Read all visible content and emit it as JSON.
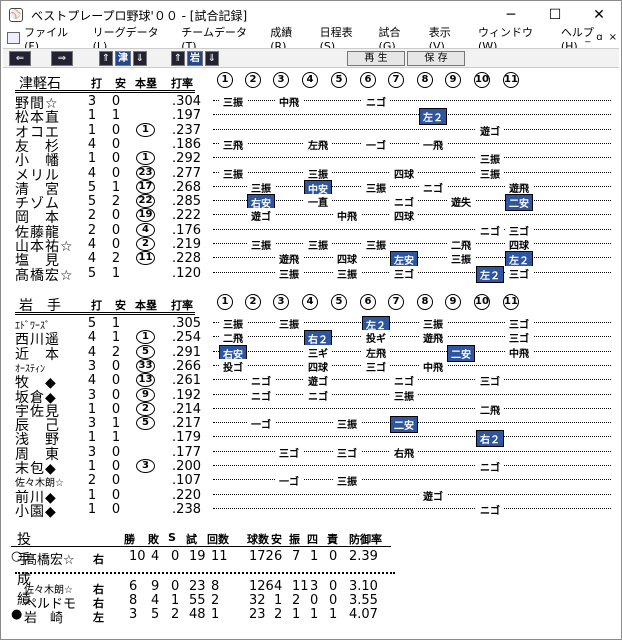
{
  "window": {
    "title": "ベストプレープロ野球'００ - [試合記録]",
    "buttons": [
      "─",
      "☐",
      "✕"
    ]
  },
  "menu": [
    "ファイル(F)",
    "リーグデータ(L)",
    "チームデータ(T)",
    "成績(R)",
    "日程表(S)",
    "試合(G)",
    "表示(V)",
    "ウィンドウ(W)",
    "ヘルプ(H)"
  ],
  "mdi": [
    "_",
    "ɑ",
    "×"
  ],
  "toolbar": {
    "prev": "⇐",
    "next": "⇒",
    "up1": "⇑",
    "team1": "津",
    "down1": "⇓",
    "up2": "⇑",
    "team2": "岩",
    "down2": "⇓",
    "play": "再 生",
    "save": "保 存"
  },
  "headers": {
    "ab": "打",
    "h": "安",
    "hr": "本塁",
    "avg": "打率"
  },
  "innings": [
    "1",
    "2",
    "3",
    "4",
    "5",
    "6",
    "7",
    "8",
    "9",
    "10",
    "11"
  ],
  "team1": {
    "name": "津軽石",
    "rows": [
      {
        "name": "野間☆",
        "ab": "3",
        "h": "0",
        "hr": "",
        "avg": ".304",
        "cells": [
          [
            0,
            "三振",
            0
          ],
          [
            2,
            "中飛",
            0
          ],
          [
            5,
            "ニゴ",
            0
          ]
        ]
      },
      {
        "name": "松本直",
        "ab": "1",
        "h": "1",
        "hr": "",
        "avg": ".197",
        "cells": [
          [
            7,
            "左２",
            1
          ]
        ]
      },
      {
        "name": "オコエ",
        "ab": "1",
        "h": "0",
        "hr": "1",
        "avg": ".237",
        "cells": [
          [
            9,
            "遊ゴ",
            0
          ]
        ]
      },
      {
        "name": "友　杉",
        "ab": "4",
        "h": "0",
        "hr": "",
        "avg": ".186",
        "cells": [
          [
            0,
            "三飛",
            0
          ],
          [
            3,
            "左飛",
            0
          ],
          [
            5,
            "一ゴ",
            0
          ],
          [
            7,
            "一飛",
            0
          ]
        ]
      },
      {
        "name": "小　幡",
        "ab": "1",
        "h": "0",
        "hr": "1",
        "avg": ".292",
        "cells": [
          [
            9,
            "三振",
            0
          ]
        ]
      },
      {
        "name": "メリル",
        "ab": "4",
        "h": "0",
        "hr": "23",
        "avg": ".277",
        "cells": [
          [
            0,
            "三振",
            0
          ],
          [
            3,
            "三振",
            0
          ],
          [
            6,
            "四球",
            0
          ],
          [
            9,
            "三振",
            0
          ]
        ]
      },
      {
        "name": "清　宮",
        "ab": "5",
        "h": "1",
        "hr": "17",
        "avg": ".268",
        "cells": [
          [
            1,
            "三振",
            0
          ],
          [
            3,
            "中安",
            1
          ],
          [
            5,
            "三振",
            0
          ],
          [
            7,
            "ニゴ",
            0
          ],
          [
            10,
            "遊飛",
            0
          ]
        ]
      },
      {
        "name": "チゾム",
        "ab": "5",
        "h": "2",
        "hr": "22",
        "avg": ".285",
        "cells": [
          [
            1,
            "右安",
            1
          ],
          [
            3,
            "一直",
            0
          ],
          [
            6,
            "ニゴ",
            0
          ],
          [
            8,
            "遊失",
            0
          ],
          [
            10,
            "二安",
            1
          ]
        ]
      },
      {
        "name": "岡　本",
        "ab": "2",
        "h": "0",
        "hr": "19",
        "avg": ".222",
        "cells": [
          [
            1,
            "遊ゴ",
            0
          ],
          [
            4,
            "中飛",
            0
          ],
          [
            6,
            "四球",
            0
          ]
        ]
      },
      {
        "name": "佐藤龍",
        "ab": "2",
        "h": "0",
        "hr": "4",
        "avg": ".176",
        "cells": [
          [
            9,
            "ニゴ",
            0
          ],
          [
            10,
            "三ゴ",
            0
          ]
        ]
      },
      {
        "name": "山本祐☆",
        "ab": "4",
        "h": "0",
        "hr": "2",
        "avg": ".219",
        "cells": [
          [
            1,
            "三振",
            0
          ],
          [
            3,
            "三振",
            0
          ],
          [
            5,
            "三振",
            0
          ],
          [
            8,
            "二飛",
            0
          ],
          [
            10,
            "四球",
            0
          ]
        ]
      },
      {
        "name": "塩　見",
        "ab": "4",
        "h": "2",
        "hr": "11",
        "avg": ".228",
        "cells": [
          [
            2,
            "遊飛",
            0
          ],
          [
            4,
            "四球",
            0
          ],
          [
            6,
            "左安",
            1
          ],
          [
            8,
            "三振",
            0
          ],
          [
            10,
            "左２",
            1
          ]
        ]
      },
      {
        "name": "髙橋宏☆",
        "ab": "5",
        "h": "1",
        "hr": "",
        "avg": ".120",
        "cells": [
          [
            2,
            "三振",
            0
          ],
          [
            4,
            "三振",
            0
          ],
          [
            6,
            "三ゴ",
            0
          ],
          [
            9,
            "左２",
            1
          ],
          [
            10,
            "三ゴ",
            0
          ]
        ]
      }
    ]
  },
  "team2": {
    "name": "岩　手",
    "rows": [
      {
        "name": "ｴﾄﾞﾜｰｽﾞ",
        "ab": "5",
        "h": "1",
        "hr": "",
        "avg": ".305",
        "cells": [
          [
            0,
            "三振",
            0
          ],
          [
            2,
            "三振",
            0
          ],
          [
            5,
            "左２",
            1
          ],
          [
            7,
            "三振",
            0
          ],
          [
            10,
            "三ゴ",
            0
          ]
        ]
      },
      {
        "name": "西川遥",
        "ab": "4",
        "h": "1",
        "hr": "1",
        "avg": ".254",
        "cells": [
          [
            0,
            "二飛",
            0
          ],
          [
            3,
            "右２",
            1
          ],
          [
            5,
            "投ギ",
            0
          ],
          [
            7,
            "遊飛",
            0
          ],
          [
            10,
            "三ゴ",
            0
          ]
        ]
      },
      {
        "name": "近　本",
        "ab": "4",
        "h": "2",
        "hr": "5",
        "avg": ".291",
        "cells": [
          [
            0,
            "右安",
            1
          ],
          [
            3,
            "三ギ",
            0
          ],
          [
            5,
            "左飛",
            0
          ],
          [
            8,
            "二安",
            1
          ],
          [
            10,
            "中飛",
            0
          ]
        ]
      },
      {
        "name": "ｵｰｽﾃｨﾝ",
        "ab": "3",
        "h": "0",
        "hr": "33",
        "avg": ".266",
        "cells": [
          [
            0,
            "投ゴ",
            0
          ],
          [
            3,
            "四球",
            0
          ],
          [
            5,
            "三ゴ",
            0
          ],
          [
            7,
            "中飛",
            0
          ]
        ]
      },
      {
        "name": "牧　◆",
        "ab": "4",
        "h": "0",
        "hr": "13",
        "avg": ".261",
        "cells": [
          [
            1,
            "ニゴ",
            0
          ],
          [
            3,
            "遊ゴ",
            0
          ],
          [
            6,
            "ニゴ",
            0
          ],
          [
            9,
            "三ゴ",
            0
          ]
        ]
      },
      {
        "name": "坂倉◆",
        "ab": "3",
        "h": "0",
        "hr": "9",
        "avg": ".192",
        "cells": [
          [
            1,
            "ニゴ",
            0
          ],
          [
            3,
            "ニゴ",
            0
          ],
          [
            6,
            "三振",
            0
          ]
        ]
      },
      {
        "name": "宇佐見",
        "ab": "1",
        "h": "0",
        "hr": "2",
        "avg": ".214",
        "cells": [
          [
            9,
            "二飛",
            0
          ]
        ]
      },
      {
        "name": "辰　己",
        "ab": "3",
        "h": "1",
        "hr": "5",
        "avg": ".217",
        "cells": [
          [
            1,
            "一ゴ",
            0
          ],
          [
            4,
            "三振",
            0
          ],
          [
            6,
            "二安",
            1
          ]
        ]
      },
      {
        "name": "浅　野",
        "ab": "1",
        "h": "1",
        "hr": "",
        "avg": ".179",
        "cells": [
          [
            9,
            "右２",
            1
          ]
        ]
      },
      {
        "name": "周　東",
        "ab": "3",
        "h": "0",
        "hr": "",
        "avg": ".177",
        "cells": [
          [
            2,
            "三ゴ",
            0
          ],
          [
            4,
            "三ゴ",
            0
          ],
          [
            6,
            "右飛",
            0
          ]
        ]
      },
      {
        "name": "末包◆",
        "ab": "1",
        "h": "0",
        "hr": "3",
        "avg": ".200",
        "cells": [
          [
            9,
            "ニゴ",
            0
          ]
        ]
      },
      {
        "name": "佐々木朗☆",
        "ab": "2",
        "h": "0",
        "hr": "",
        "avg": ".107",
        "cells": [
          [
            2,
            "一ゴ",
            0
          ],
          [
            4,
            "三振",
            0
          ]
        ]
      },
      {
        "name": "前川◆",
        "ab": "1",
        "h": "0",
        "hr": "",
        "avg": ".220",
        "cells": [
          [
            7,
            "遊ゴ",
            0
          ]
        ]
      },
      {
        "name": "小園◆",
        "ab": "1",
        "h": "0",
        "hr": "",
        "avg": ".238",
        "cells": [
          [
            9,
            "ニゴ",
            0
          ]
        ]
      }
    ]
  },
  "pitching": {
    "title": "投手成績",
    "headers": [
      "勝",
      "敗",
      "S",
      "試",
      "回数",
      "球数",
      "安",
      "振",
      "四",
      "責",
      "防御率"
    ],
    "rows": [
      {
        "mark": "○",
        "name": "髙橋宏☆",
        "hand": "右",
        "vals": [
          "10",
          "4",
          "0",
          "19",
          "11",
          "172",
          "6",
          "7",
          "1",
          "0",
          "2.39"
        ]
      },
      {
        "mark": "",
        "name": "佐々木朗☆",
        "hand": "右",
        "vals": [
          "6",
          "9",
          "0",
          "23",
          "8",
          "126",
          "4",
          "11",
          "3",
          "0",
          "3.10"
        ]
      },
      {
        "mark": "",
        "name": "ペルドモ",
        "hand": "右",
        "vals": [
          "8",
          "4",
          "1",
          "55",
          "2",
          "32",
          "1",
          "2",
          "0",
          "0",
          "3.55"
        ]
      },
      {
        "mark": "●",
        "name": "岩　崎",
        "hand": "左",
        "vals": [
          "3",
          "5",
          "2",
          "48",
          "1",
          "23",
          "2",
          "1",
          "1",
          "1",
          "4.07"
        ]
      }
    ]
  }
}
